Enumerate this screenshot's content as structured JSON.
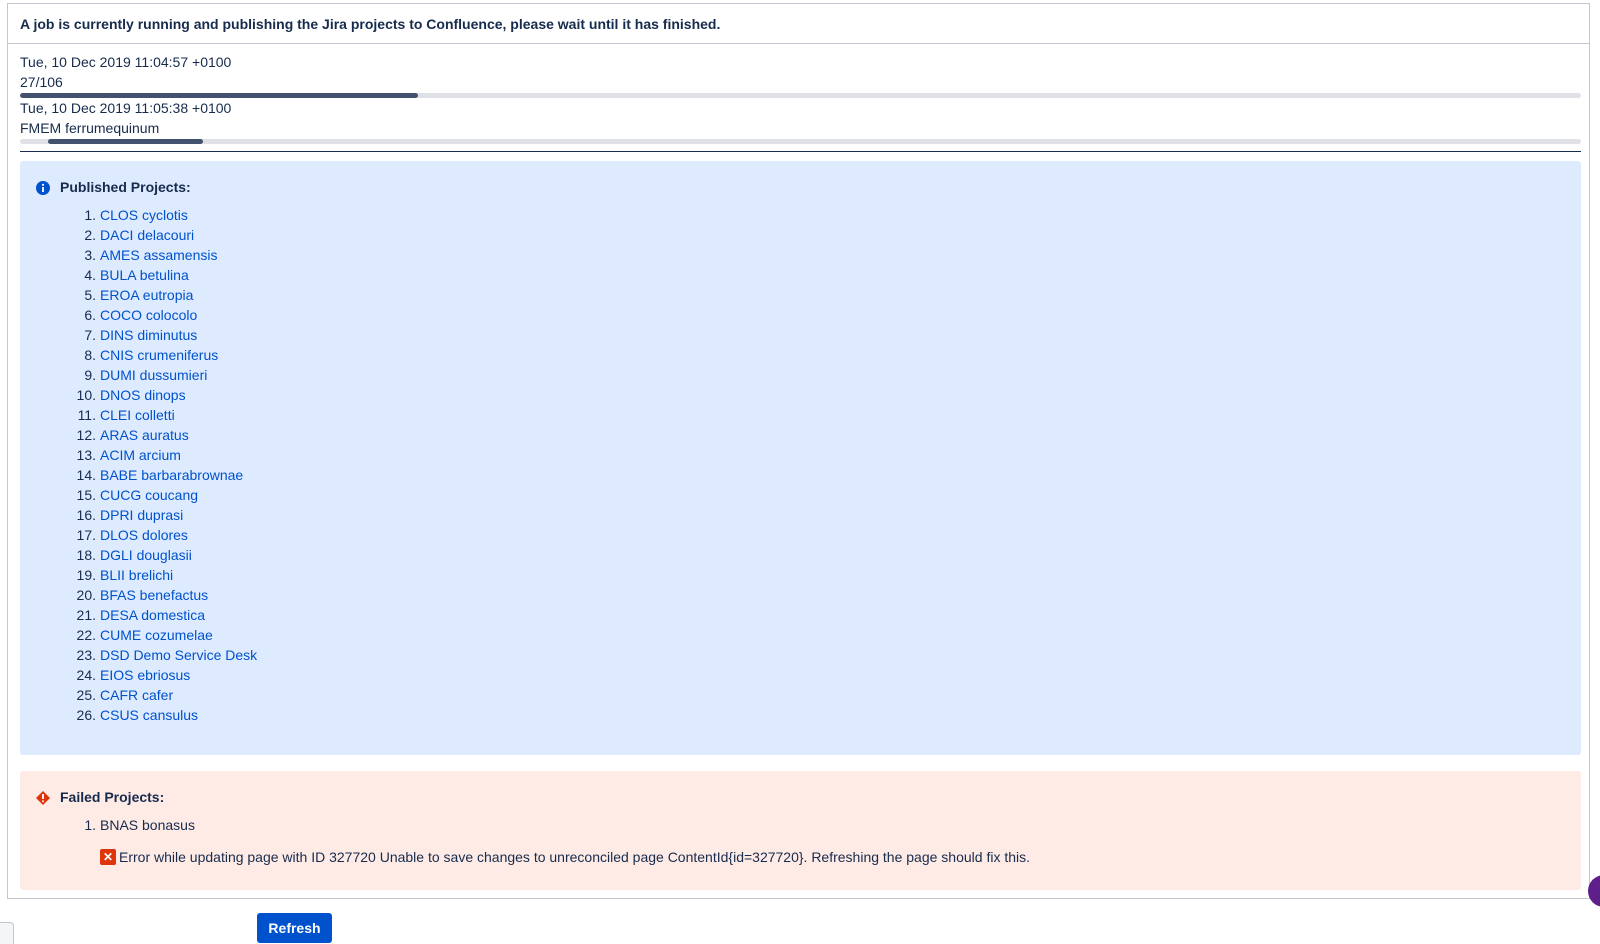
{
  "header": {
    "message": "A job is currently running and publishing the Jira projects to Confluence, please wait until it has finished."
  },
  "job": {
    "started": "Tue, 10 Dec 2019 11:04:57 +0100",
    "progress_text": "27/106",
    "progress_fraction": 0.255,
    "current_time": "Tue, 10 Dec 2019 11:05:38 +0100",
    "current_project": "FMEM ferrumequinum"
  },
  "published": {
    "title": "Published Projects:",
    "items": [
      "CLOS cyclotis",
      "DACI delacouri",
      "AMES assamensis",
      "BULA betulina",
      "EROA eutropia",
      "COCO colocolo",
      "DINS diminutus",
      "CNIS crumeniferus",
      "DUMI dussumieri",
      "DNOS dinops",
      "CLEI colletti",
      "ARAS auratus",
      "ACIM arcium",
      "BABE barbarabrownae",
      "CUCG coucang",
      "DPRI duprasi",
      "DLOS dolores",
      "DGLI douglasii",
      "BLII brelichi",
      "BFAS benefactus",
      "DESA domestica",
      "CUME cozumelae",
      "DSD Demo Service Desk",
      "EIOS ebriosus",
      "CAFR cafer",
      "CSUS cansulus"
    ]
  },
  "failed": {
    "title": "Failed Projects:",
    "items": [
      "BNAS bonasus"
    ],
    "error": "Error while updating page with ID 327720 Unable to save changes to unreconciled page ContentId{id=327720}. Refreshing the page should fix this."
  },
  "actions": {
    "refresh_label": "Refresh"
  },
  "icons": {
    "info": "info-icon",
    "failed": "warning-icon",
    "error": "error-x-icon"
  },
  "colors": {
    "info_bg": "#deebff",
    "error_bg": "#ffebe6",
    "link": "#0052cc",
    "primary_button": "#0052cc",
    "progress_fill": "#42526e",
    "error_icon": "#de350b"
  }
}
